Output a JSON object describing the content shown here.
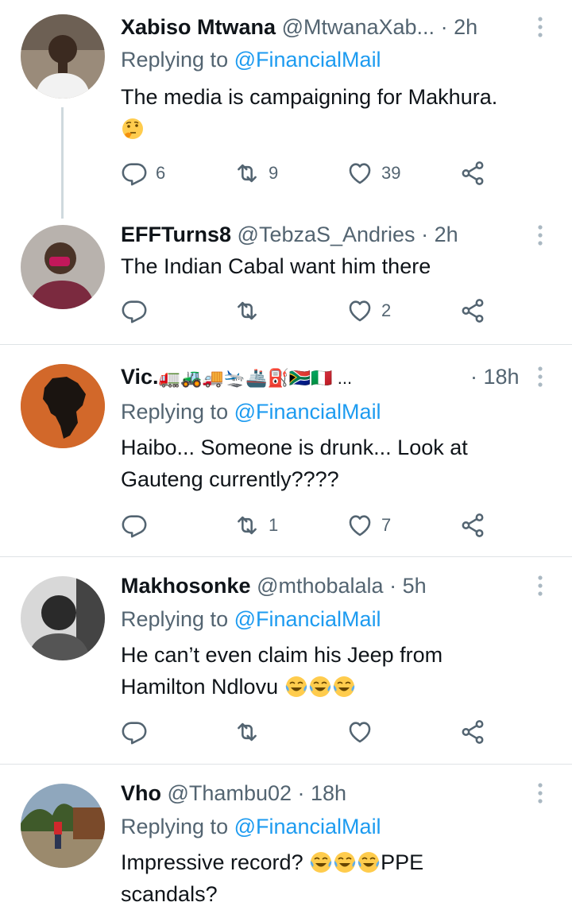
{
  "tweets": [
    {
      "name": "Xabiso Mtwana",
      "handle": "@MtwanaXab...",
      "time": "· 2h",
      "replying_prefix": "Replying to ",
      "replying_to": "@FinancialMail",
      "text": "The media is campaigning for Makhura.",
      "emoji": "thinking-face",
      "replies": "6",
      "retweets": "9",
      "likes": "39"
    },
    {
      "name": "EFFTurns8",
      "handle": "@TebzaS_Andries",
      "time": "· 2h",
      "text": "The Indian Cabal want him there",
      "replies": "",
      "retweets": "",
      "likes": "2"
    },
    {
      "name": "Vic.",
      "name_emoji": "🚛🚜🚚🛬🚢⛽🇿🇦🇮🇹 ...",
      "time": "· 18h",
      "replying_prefix": "Replying to ",
      "replying_to": "@FinancialMail",
      "text_line1": "Haibo... Someone is drunk... Look at",
      "text_line2": "Gauteng currently????",
      "replies": "",
      "retweets": "1",
      "likes": "7"
    },
    {
      "name": "Makhosonke",
      "handle": "@mthobalala",
      "time": "· 5h",
      "replying_prefix": "Replying to ",
      "replying_to": "@FinancialMail",
      "text_line1": "He can’t even claim his Jeep from",
      "text_line2": "Hamilton Ndlovu",
      "emoji": "face-with-tears-of-joy",
      "replies": "",
      "retweets": "",
      "likes": ""
    },
    {
      "name": "Vho",
      "handle": "@Thambu02",
      "time": "· 18h",
      "replying_prefix": "Replying to ",
      "replying_to": "@FinancialMail",
      "text_line1a": "Impressive record? ",
      "text_line1b": "PPE",
      "text_line2": "scandals?"
    }
  ],
  "colors": {
    "link": "#1d9bf0",
    "secondary": "#536471",
    "text": "#0f1419",
    "divider": "#dfe3e6"
  }
}
